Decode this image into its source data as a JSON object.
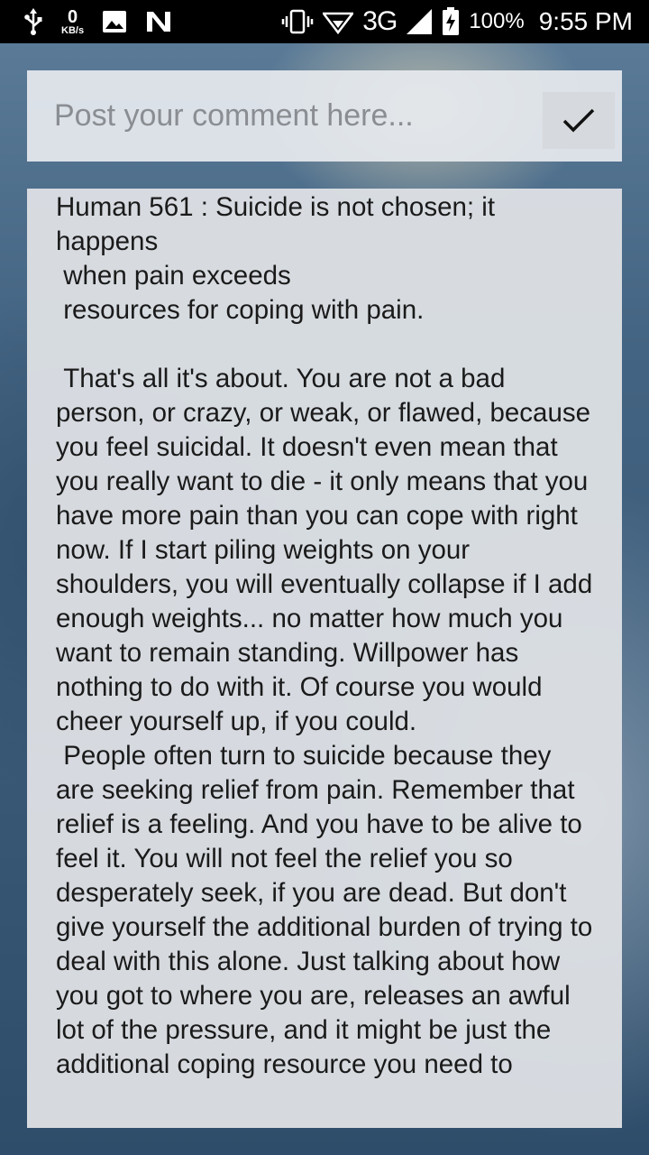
{
  "status_bar": {
    "data_rate_value": "0",
    "data_rate_unit": "KB/s",
    "network_type": "3G",
    "battery_percent": "100%",
    "time": "9:55 PM",
    "icons": {
      "usb": "usb-icon",
      "image": "image-icon",
      "n_logo": "n-logo-icon",
      "vibrate": "vibrate-icon",
      "wifi": "wifi-icon",
      "signal": "signal-icon",
      "battery": "battery-charging-icon"
    }
  },
  "comment_input": {
    "placeholder": "Post your comment here...",
    "value": "",
    "submit_icon": "checkmark-icon"
  },
  "comment": {
    "text": "Human 561 : Suicide is not chosen; it happens\n when pain exceeds\n resources for coping with pain.\n\n That's all it's about. You are not a bad person, or crazy, or weak, or flawed, because you feel suicidal. It doesn't even mean that you really want to die - it only means that you have more pain than you can cope with right now. If I start piling weights on your shoulders, you will eventually collapse if I add enough weights... no matter how much you want to remain standing. Willpower has nothing to do with it. Of course you would cheer yourself up, if you could.\n People often turn to suicide because they are seeking relief from pain. Remember that relief is a feeling. And you have to be alive to feel it. You will not feel the relief you so desperately seek, if you are dead. But don't give yourself the additional burden of trying to deal with this alone. Just talking about how you got to where you are, releases an awful lot of the pressure, and it might be just the additional coping resource you need to"
  },
  "colors": {
    "status_bar_bg": "#000000",
    "panel_bg": "#dde0e4",
    "input_bg": "#e7eaef",
    "placeholder": "#8a8d92",
    "text": "#1a1a1a"
  }
}
